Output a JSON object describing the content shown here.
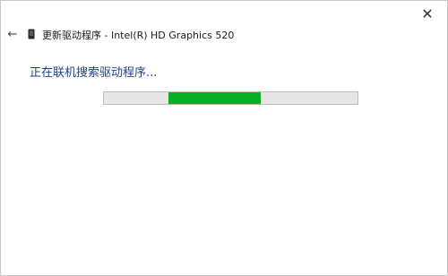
{
  "window": {
    "close_glyph": "✕",
    "back_glyph": "←"
  },
  "header": {
    "title": "更新驱动程序 - Intel(R) HD Graphics 520"
  },
  "main": {
    "status_text": "正在联机搜索驱动程序...",
    "progress": {
      "indeterminate": true,
      "start_fraction": 0.255,
      "end_fraction": 0.62,
      "fill_color": "#06b025",
      "track_color": "#e6e6e6"
    }
  },
  "icons": {
    "back": "arrow-left-icon",
    "device": "display-adapter-icon",
    "close": "close-icon"
  }
}
